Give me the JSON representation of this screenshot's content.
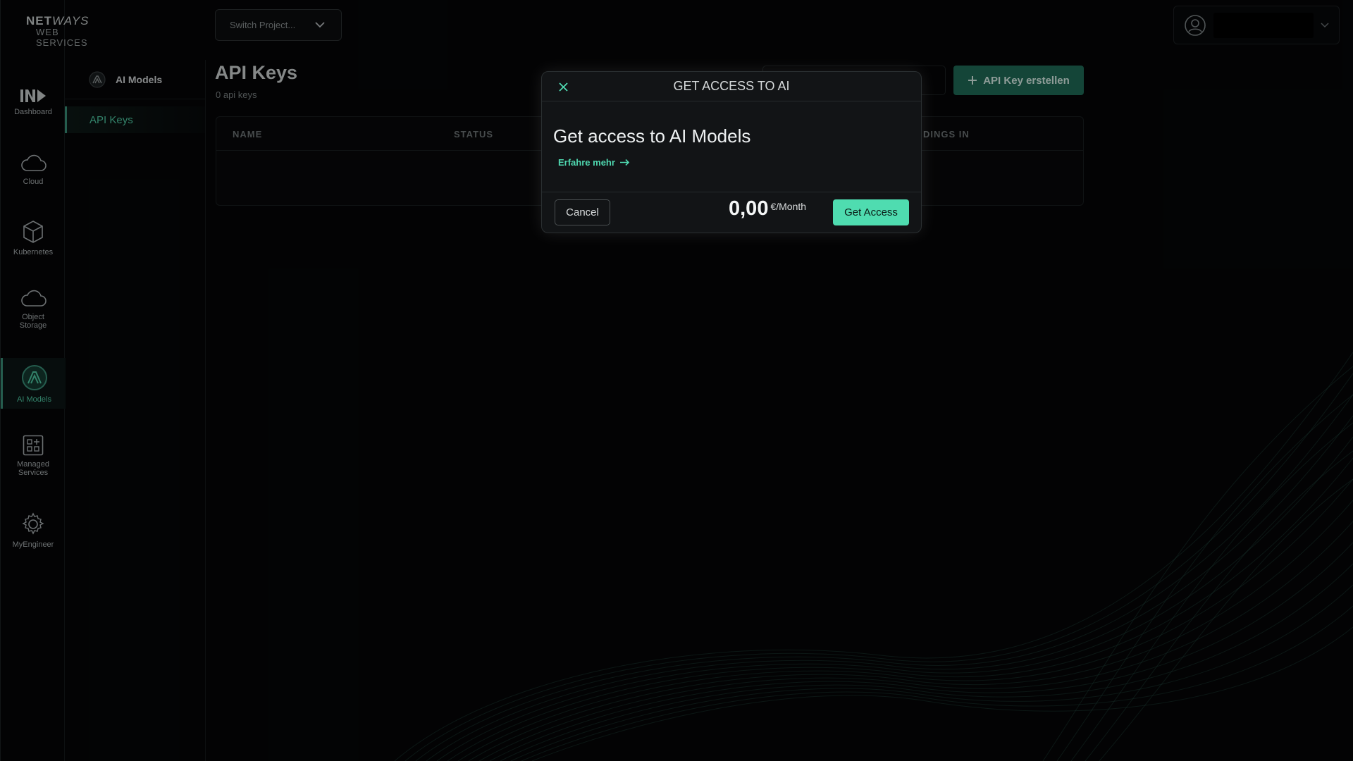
{
  "brand": {
    "line1_bold": "NET",
    "line1_italic": "WAYS",
    "line2": "WEB SERVICES"
  },
  "project_switcher": {
    "label": "Switch Project..."
  },
  "nav": {
    "items": [
      {
        "label": "Dashboard",
        "icon": "dashboard-logo-icon"
      },
      {
        "label": "Cloud",
        "icon": "cloud-icon"
      },
      {
        "label": "Kubernetes",
        "icon": "cube-icon"
      },
      {
        "label": "Object\nStorage",
        "icon": "cloud-storage-icon"
      },
      {
        "label": "AI Models",
        "icon": "ai-models-icon",
        "active": true
      },
      {
        "label": "Managed\nServices",
        "icon": "apps-grid-icon"
      },
      {
        "label": "MyEngineer",
        "icon": "gear-icon"
      }
    ]
  },
  "sub_nav": {
    "header": "AI Models",
    "items": [
      {
        "label": "API Keys",
        "active": true
      }
    ]
  },
  "main": {
    "title": "API Keys",
    "subtitle": "0 api keys",
    "create_button": "API Key erstellen",
    "table": {
      "columns": [
        "NAME",
        "STATUS",
        "DINGS IN"
      ]
    }
  },
  "modal": {
    "title": "GET ACCESS TO AI",
    "heading": "Get access to AI Models",
    "learn_more": "Erfahre mehr",
    "cancel": "Cancel",
    "price_value": "0,00",
    "price_unit": "€/Month",
    "confirm": "Get Access"
  },
  "colors": {
    "accent": "#4fdcb0",
    "accent_dark": "#1f6b57",
    "background": "#050607",
    "modal_bg": "#121416"
  }
}
